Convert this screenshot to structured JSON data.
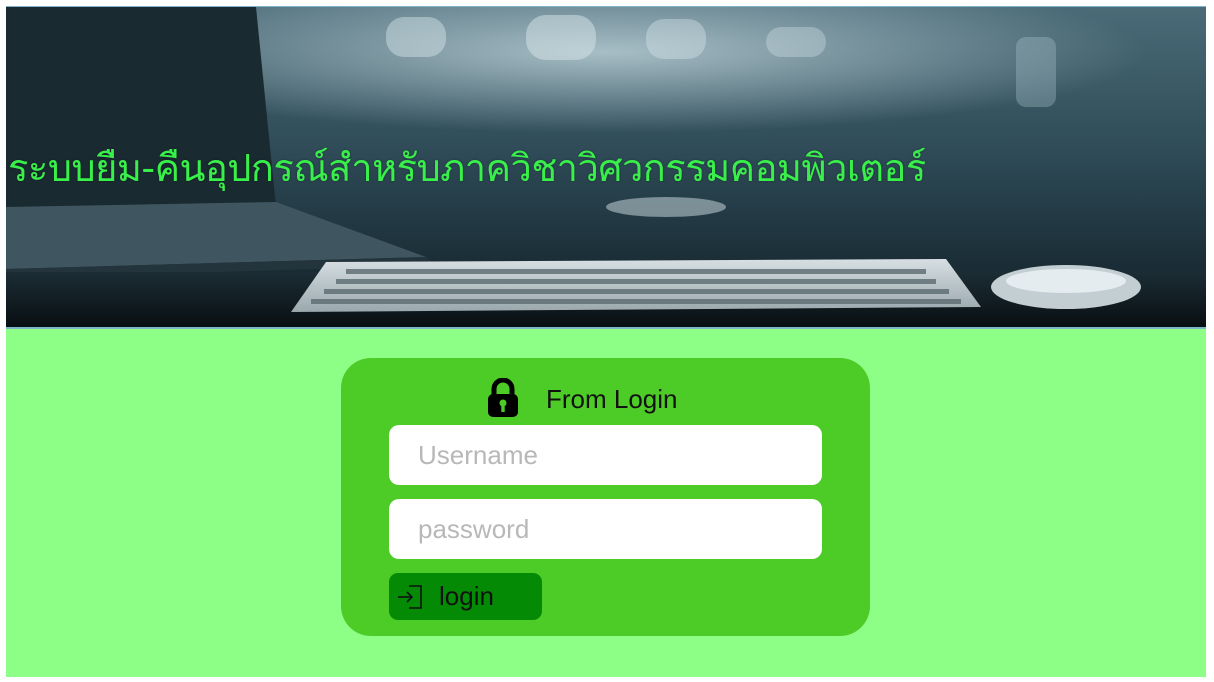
{
  "banner": {
    "title": "ระบบยืม-คืนอุปกรณ์สำหรับภาควิชาวิศวกรรมคอมพิวเตอร์"
  },
  "login_form": {
    "title": "From Login",
    "lock_icon": "lock-icon",
    "username": {
      "placeholder": "Username",
      "value": ""
    },
    "password": {
      "placeholder": "password",
      "value": ""
    },
    "submit": {
      "label": "login",
      "icon": "sign-in-icon"
    }
  },
  "colors": {
    "page_background": "#8dfe86",
    "card_background": "#4dcb26",
    "button_background": "#048a04",
    "title_text": "#39f04a",
    "input_background": "#ffffff"
  }
}
